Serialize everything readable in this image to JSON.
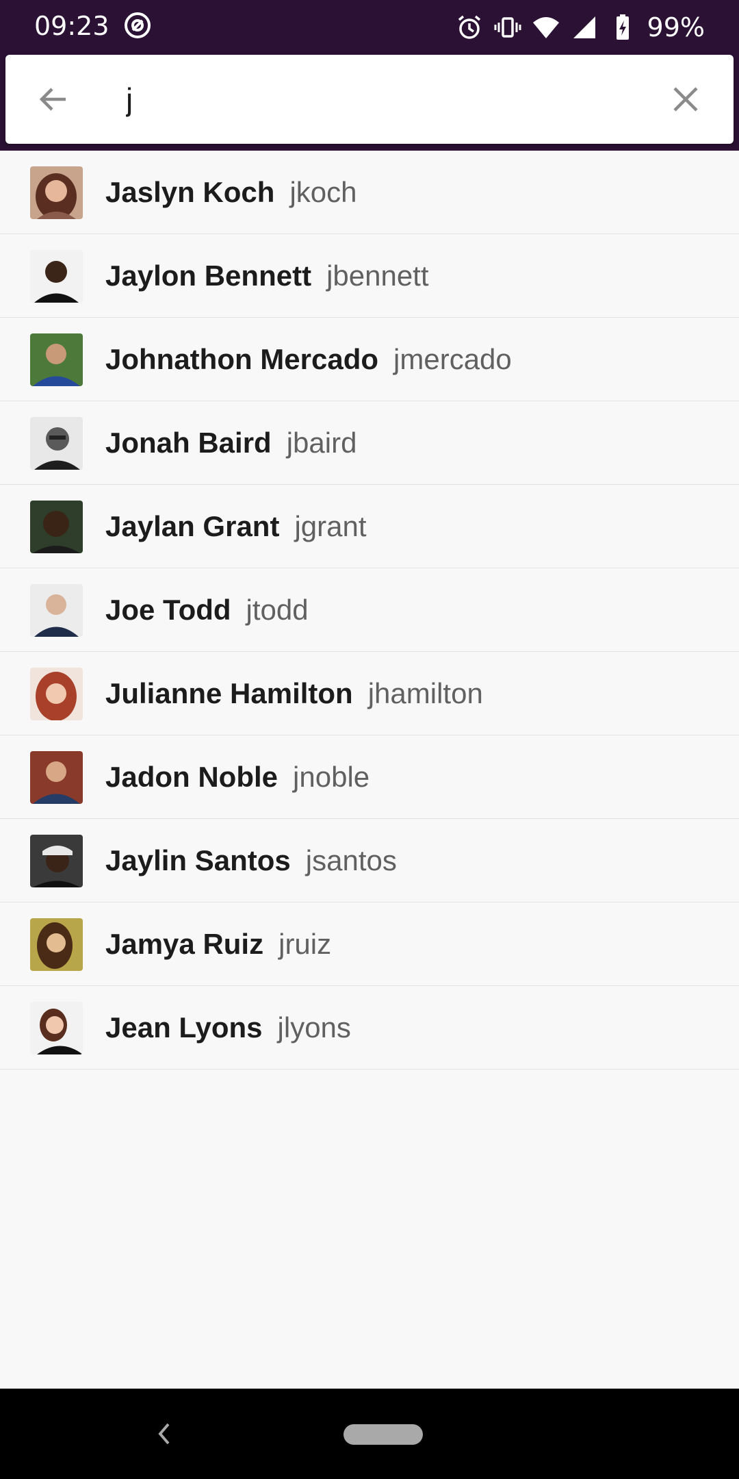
{
  "status_bar": {
    "time": "09:23",
    "app_icon": "at-sign-icon",
    "icons": [
      "alarm-icon",
      "vibrate-icon",
      "wifi-icon",
      "signal-icon",
      "battery-charging-icon"
    ],
    "battery_percent": "99%"
  },
  "search": {
    "query": "j",
    "back_icon": "arrow-left-icon",
    "clear_icon": "close-icon"
  },
  "results": [
    {
      "name": "Jaslyn Koch",
      "handle": "jkoch"
    },
    {
      "name": "Jaylon Bennett",
      "handle": "jbennett"
    },
    {
      "name": "Johnathon Mercado",
      "handle": "jmercado"
    },
    {
      "name": "Jonah Baird",
      "handle": "jbaird"
    },
    {
      "name": "Jaylan Grant",
      "handle": "jgrant"
    },
    {
      "name": "Joe Todd",
      "handle": "jtodd"
    },
    {
      "name": "Julianne Hamilton",
      "handle": "jhamilton"
    },
    {
      "name": "Jadon Noble",
      "handle": "jnoble"
    },
    {
      "name": "Jaylin Santos",
      "handle": "jsantos"
    },
    {
      "name": "Jamya Ruiz",
      "handle": "jruiz"
    },
    {
      "name": "Jean Lyons",
      "handle": "jlyons"
    }
  ],
  "nav_bar": {
    "back_icon": "nav-back-icon",
    "home_icon": "home-pill-icon"
  },
  "colors": {
    "header_bg": "#2b1133",
    "name_text": "#1d1c1d",
    "handle_text": "#616061",
    "list_bg": "#f8f8f8"
  }
}
